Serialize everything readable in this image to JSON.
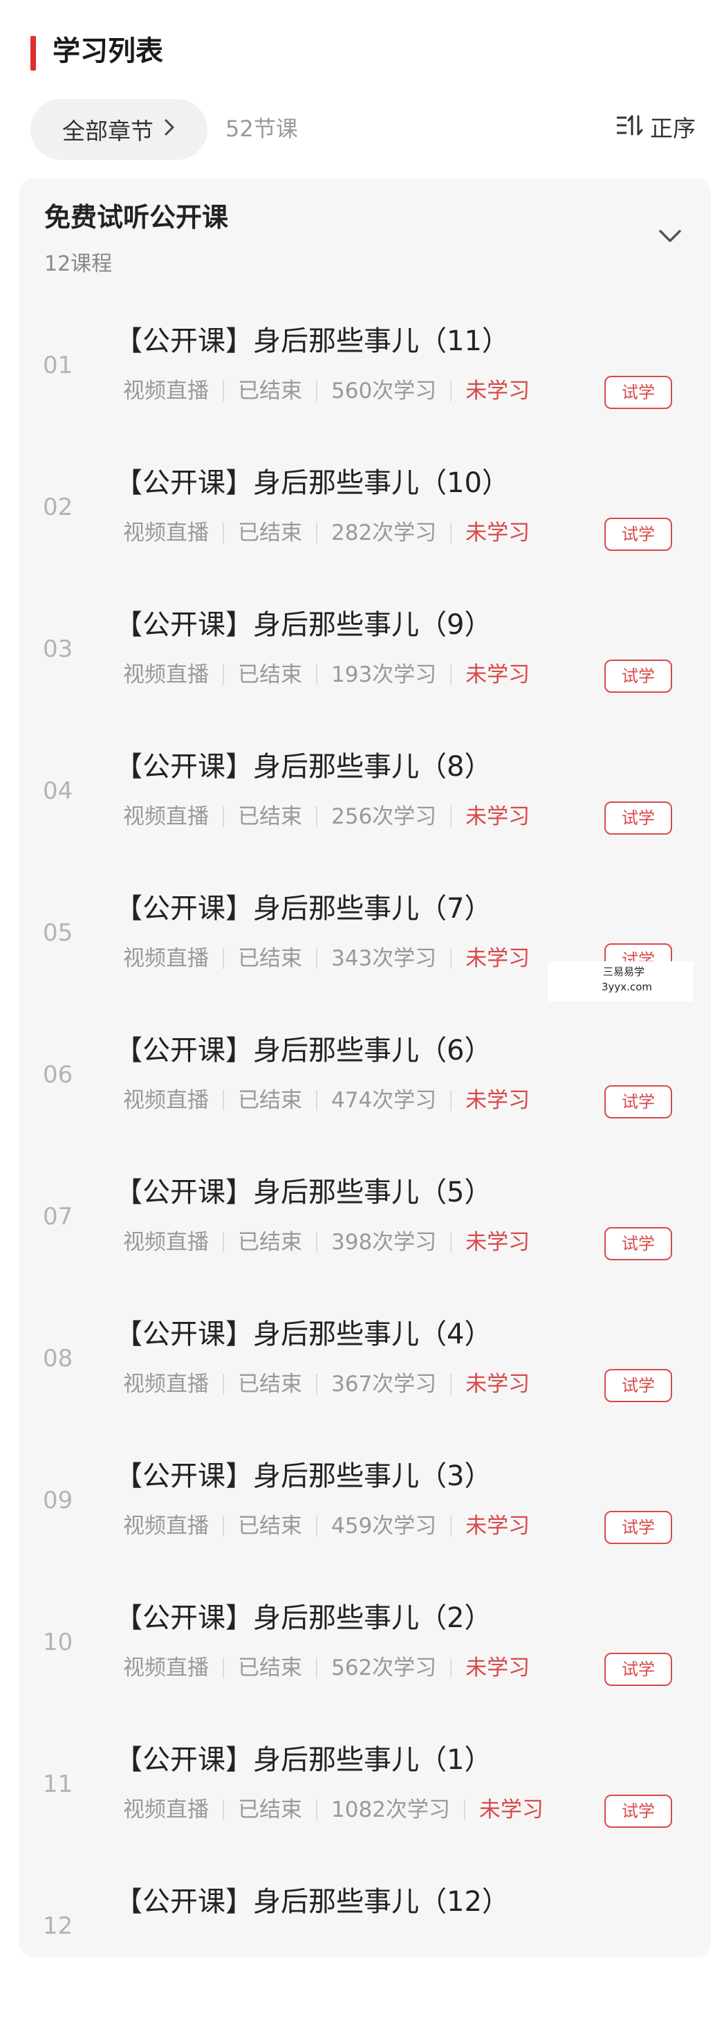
{
  "header": {
    "title": "学习列表",
    "accent_color": "#e02e2e"
  },
  "filter": {
    "all_chapters_label": "全部章节",
    "chevron_icon": "chevron-right-icon",
    "lesson_count": "52节课",
    "sort_label": "正序",
    "sort_icon": "sort-icon"
  },
  "section": {
    "title": "免费试听公开课",
    "subtitle": "12课程",
    "toggle_icon": "chevron-down-icon"
  },
  "lessons": [
    {
      "num": "01",
      "title": "【公开课】身后那些事儿（11）",
      "type": "视频直播",
      "state": "已结束",
      "views": "560次学习",
      "status": "未学习",
      "action": "试学"
    },
    {
      "num": "02",
      "title": "【公开课】身后那些事儿（10）",
      "type": "视频直播",
      "state": "已结束",
      "views": "282次学习",
      "status": "未学习",
      "action": "试学"
    },
    {
      "num": "03",
      "title": "【公开课】身后那些事儿（9）",
      "type": "视频直播",
      "state": "已结束",
      "views": "193次学习",
      "status": "未学习",
      "action": "试学"
    },
    {
      "num": "04",
      "title": "【公开课】身后那些事儿（8）",
      "type": "视频直播",
      "state": "已结束",
      "views": "256次学习",
      "status": "未学习",
      "action": "试学"
    },
    {
      "num": "05",
      "title": "【公开课】身后那些事儿（7）",
      "type": "视频直播",
      "state": "已结束",
      "views": "343次学习",
      "status": "未学习",
      "action": "试学"
    },
    {
      "num": "06",
      "title": "【公开课】身后那些事儿（6）",
      "type": "视频直播",
      "state": "已结束",
      "views": "474次学习",
      "status": "未学习",
      "action": "试学"
    },
    {
      "num": "07",
      "title": "【公开课】身后那些事儿（5）",
      "type": "视频直播",
      "state": "已结束",
      "views": "398次学习",
      "status": "未学习",
      "action": "试学"
    },
    {
      "num": "08",
      "title": "【公开课】身后那些事儿（4）",
      "type": "视频直播",
      "state": "已结束",
      "views": "367次学习",
      "status": "未学习",
      "action": "试学"
    },
    {
      "num": "09",
      "title": "【公开课】身后那些事儿（3）",
      "type": "视频直播",
      "state": "已结束",
      "views": "459次学习",
      "status": "未学习",
      "action": "试学"
    },
    {
      "num": "10",
      "title": "【公开课】身后那些事儿（2）",
      "type": "视频直播",
      "state": "已结束",
      "views": "562次学习",
      "status": "未学习",
      "action": "试学"
    },
    {
      "num": "11",
      "title": "【公开课】身后那些事儿（1）",
      "type": "视频直播",
      "state": "已结束",
      "views": "1082次学习",
      "status": "未学习",
      "action": "试学"
    },
    {
      "num": "12",
      "title": "【公开课】身后那些事儿（12）",
      "type": "",
      "state": "",
      "views": "",
      "status": "",
      "action": ""
    }
  ],
  "watermark": {
    "line1": "三易易学",
    "line2": "3yyx.com"
  },
  "colors": {
    "status_red": "#d94848",
    "muted_gray": "#999999"
  }
}
